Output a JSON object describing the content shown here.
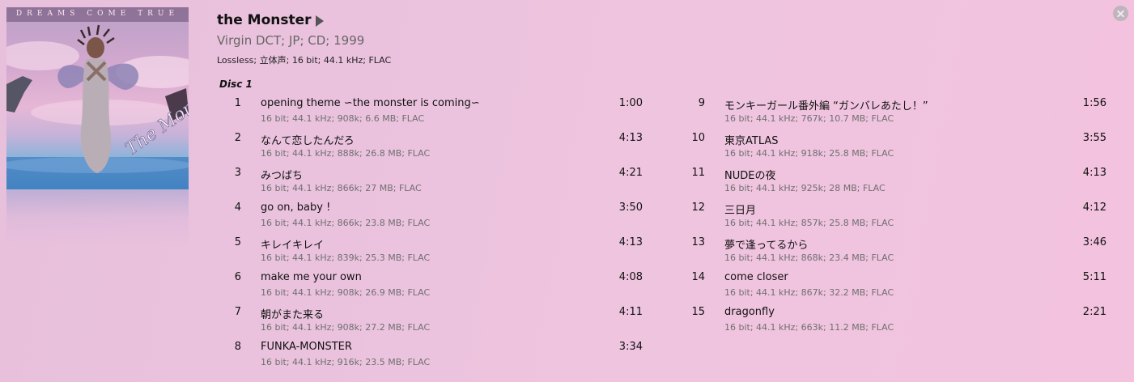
{
  "album": {
    "art_band_text": "DREAMS COME TRUE",
    "art_logo_text": "The Monster",
    "title": "the Monster",
    "subtitle": "Virgin DCT; JP; CD; 1999",
    "format": "Lossless; 立体声; 16 bit; 44.1 kHz; FLAC",
    "disc_label": "Disc 1"
  },
  "colors": {
    "background": "#ecc3de",
    "secondary_text": "#6f6f6f",
    "close_button": "#bfb5bd"
  },
  "icons": {
    "play": "play-triangle-icon",
    "close": "close-circle-icon"
  },
  "tracks_left": [
    {
      "num": "1",
      "title": "opening theme ∽the monster is coming∽",
      "info": "16 bit; 44.1 kHz; 908k; 6.6 MB; FLAC",
      "duration": "1:00"
    },
    {
      "num": "2",
      "title": "なんて恋したんだろ",
      "info": "16 bit; 44.1 kHz; 888k; 26.8 MB; FLAC",
      "duration": "4:13"
    },
    {
      "num": "3",
      "title": "みつばち",
      "info": "16 bit; 44.1 kHz; 866k; 27 MB; FLAC",
      "duration": "4:21"
    },
    {
      "num": "4",
      "title": "go on, baby !",
      "info": "16 bit; 44.1 kHz; 866k; 23.8 MB; FLAC",
      "duration": "3:50"
    },
    {
      "num": "5",
      "title": "キレイキレイ",
      "info": "16 bit; 44.1 kHz; 839k; 25.3 MB; FLAC",
      "duration": "4:13"
    },
    {
      "num": "6",
      "title": "make me your own",
      "info": "16 bit; 44.1 kHz; 908k; 26.9 MB; FLAC",
      "duration": "4:08"
    },
    {
      "num": "7",
      "title": "朝がまた来る",
      "info": "16 bit; 44.1 kHz; 908k; 27.2 MB; FLAC",
      "duration": "4:11"
    },
    {
      "num": "8",
      "title": "FUNKA-MONSTER",
      "info": "16 bit; 44.1 kHz; 916k; 23.5 MB; FLAC",
      "duration": "3:34"
    }
  ],
  "tracks_right": [
    {
      "num": "9",
      "title": "モンキーガール番外編 “ガンバレあたし！”",
      "info": "16 bit; 44.1 kHz; 767k; 10.7 MB; FLAC",
      "duration": "1:56"
    },
    {
      "num": "10",
      "title": "東京ATLAS",
      "info": "16 bit; 44.1 kHz; 918k; 25.8 MB; FLAC",
      "duration": "3:55"
    },
    {
      "num": "11",
      "title": "NUDEの夜",
      "info": "16 bit; 44.1 kHz; 925k; 28 MB; FLAC",
      "duration": "4:13"
    },
    {
      "num": "12",
      "title": "三日月",
      "info": "16 bit; 44.1 kHz; 857k; 25.8 MB; FLAC",
      "duration": "4:12"
    },
    {
      "num": "13",
      "title": "夢で逢ってるから",
      "info": "16 bit; 44.1 kHz; 868k; 23.4 MB; FLAC",
      "duration": "3:46"
    },
    {
      "num": "14",
      "title": "come closer",
      "info": "16 bit; 44.1 kHz; 867k; 32.2 MB; FLAC",
      "duration": "5:11"
    },
    {
      "num": "15",
      "title": "dragonfly",
      "info": "16 bit; 44.1 kHz; 663k; 11.2 MB; FLAC",
      "duration": "2:21"
    }
  ]
}
